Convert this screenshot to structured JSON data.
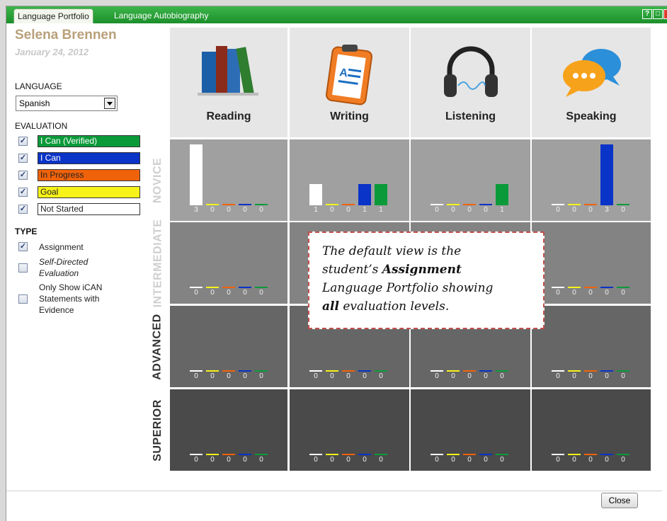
{
  "tabs": [
    "Language Portfolio",
    "Language Autobiography"
  ],
  "window_buttons": [
    "?",
    "□"
  ],
  "student": {
    "name": "Selena Brennen",
    "date": "January 24, 2012"
  },
  "language": {
    "label": "LANGUAGE",
    "selected": "Spanish"
  },
  "evaluation": {
    "label": "EVALUATION",
    "items": [
      {
        "label": "I Can (Verified)",
        "color": "#0b9a3a",
        "text_color": "#ffffff",
        "checked": true
      },
      {
        "label": "I Can",
        "color": "#0a33c7",
        "text_color": "#ffffff",
        "checked": true
      },
      {
        "label": "In Progress",
        "color": "#f0620a",
        "text_color": "#222222",
        "checked": true
      },
      {
        "label": "Goal",
        "color": "#f7f21a",
        "text_color": "#222222",
        "checked": true
      },
      {
        "label": "Not Started",
        "color": "#ffffff",
        "text_color": "#222222",
        "checked": true
      }
    ]
  },
  "type": {
    "label": "TYPE",
    "items": [
      {
        "label": "Assignment",
        "checked": true
      },
      {
        "label": "Self-Directed Evaluation",
        "checked": false
      },
      {
        "label": "Only Show iCAN Statements with Evidence",
        "checked": false
      }
    ]
  },
  "skills": [
    {
      "name": "Reading",
      "icon": "books-icon"
    },
    {
      "name": "Writing",
      "icon": "clipboard-icon"
    },
    {
      "name": "Listening",
      "icon": "headphones-icon"
    },
    {
      "name": "Speaking",
      "icon": "speech-bubbles-icon"
    }
  ],
  "levels": [
    {
      "name": "NOVICE",
      "bg": "#a0a0a0",
      "label_color": "#cfcfcf"
    },
    {
      "name": "INTERMEDIATE",
      "bg": "#838383",
      "label_color": "#cfcfcf"
    },
    {
      "name": "ADVANCED",
      "bg": "#666666",
      "label_color": "#333333"
    },
    {
      "name": "SUPERIOR",
      "bg": "#4a4a4a",
      "label_color": "#333333"
    }
  ],
  "bar_colors": [
    "#ffffff",
    "#f7f21a",
    "#f0620a",
    "#0a33c7",
    "#0b9a3a"
  ],
  "counts": {
    "NOVICE": [
      [
        3,
        0,
        0,
        0,
        0
      ],
      [
        1,
        0,
        0,
        1,
        1
      ],
      [
        0,
        0,
        0,
        0,
        1
      ],
      [
        0,
        0,
        0,
        3,
        0
      ]
    ],
    "INTERMEDIATE": [
      [
        0,
        0,
        0,
        0,
        0
      ],
      null,
      null,
      [
        0,
        0,
        0,
        0,
        0
      ]
    ],
    "ADVANCED": [
      [
        0,
        0,
        0,
        0,
        0
      ],
      [
        0,
        0,
        0,
        0,
        0
      ],
      [
        0,
        0,
        0,
        0,
        0
      ],
      [
        0,
        0,
        0,
        0,
        0
      ]
    ],
    "SUPERIOR": [
      [
        0,
        0,
        0,
        0,
        0
      ],
      [
        0,
        0,
        0,
        0,
        0
      ],
      [
        0,
        0,
        0,
        0,
        0
      ],
      [
        0,
        0,
        0,
        0,
        0
      ]
    ]
  },
  "bar_scale_max": 3,
  "callout": {
    "line1": "The default view is the",
    "line2_pre": "student’s ",
    "line2_bold": "Assignment",
    "line3": "Language Portfolio showing",
    "line4_bold": "all",
    "line4_post": " evaluation levels."
  },
  "close_label": "Close"
}
